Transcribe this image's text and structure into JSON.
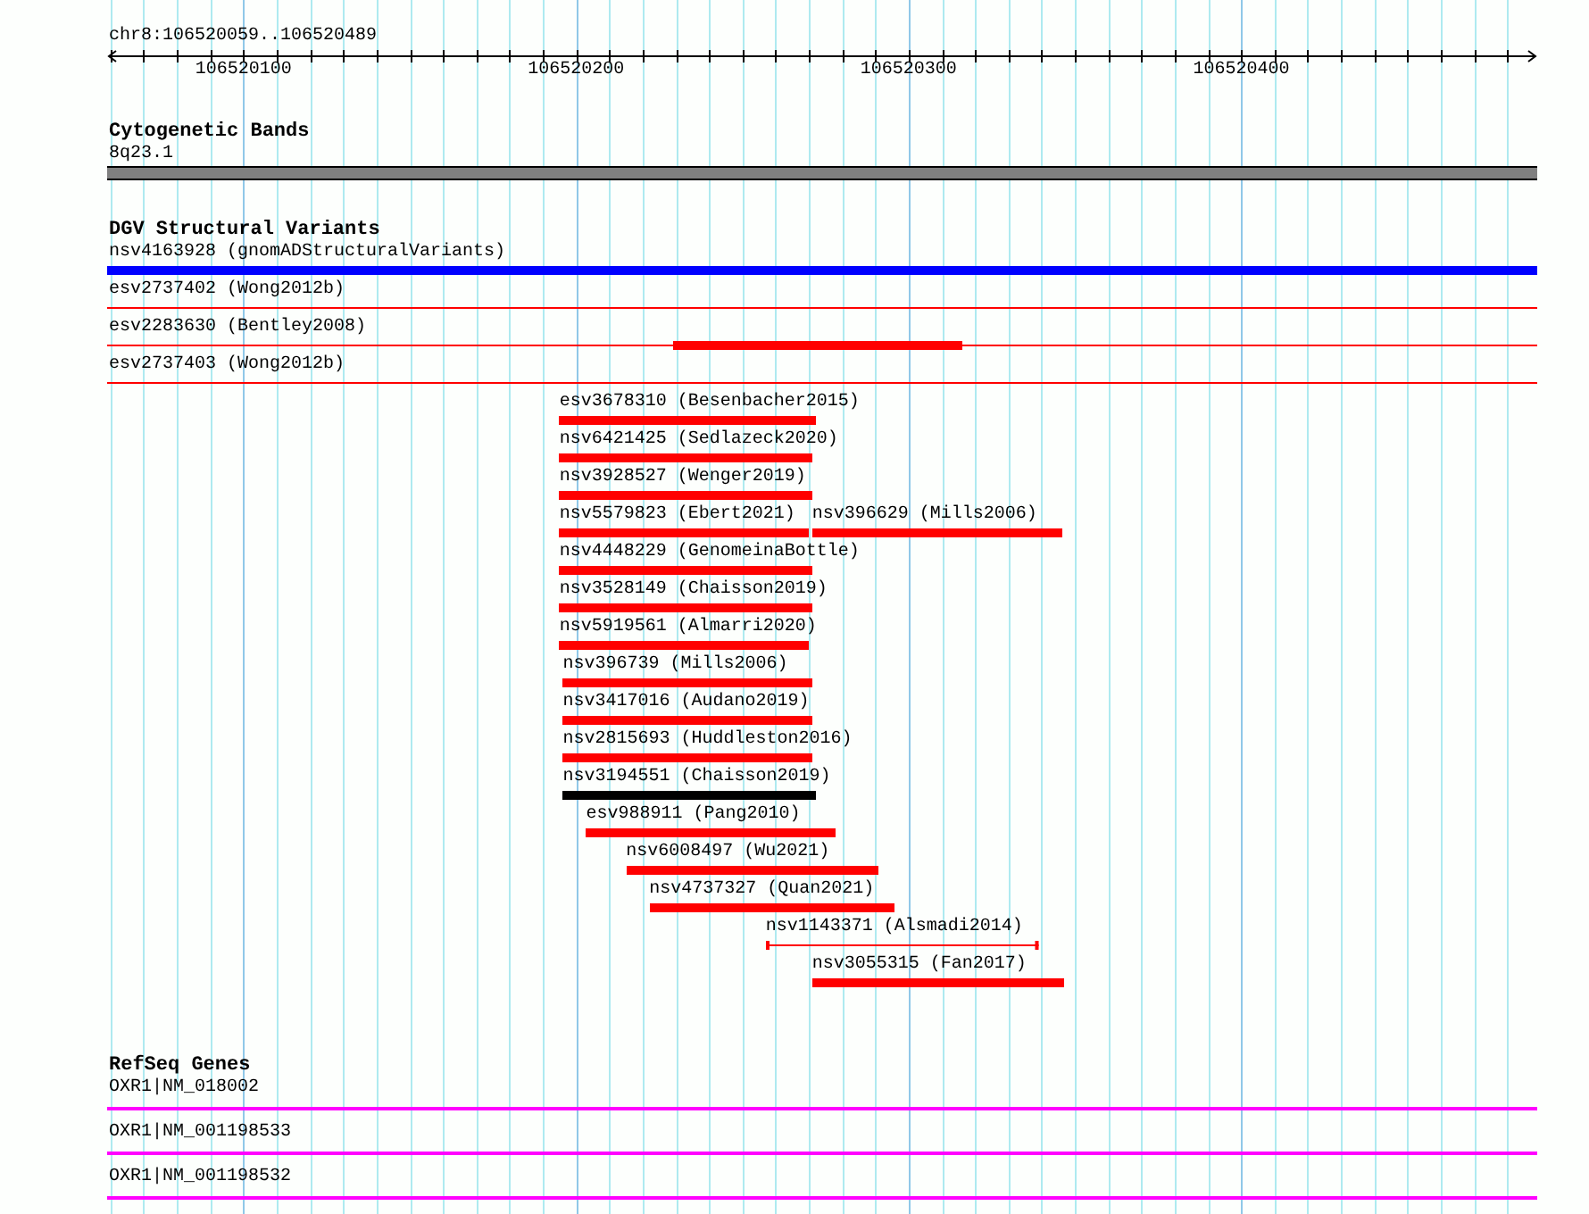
{
  "location": "chr8:106520059..106520489",
  "ruler": {
    "ticks": [
      "106520100",
      "106520200",
      "106520300",
      "106520400"
    ]
  },
  "tracks": [
    {
      "kind": "bands",
      "title": "Cytogenetic Bands",
      "rows": [
        {
          "features": [
            {
              "label": "8q23.1",
              "kind": "band",
              "color": "#808080"
            }
          ]
        }
      ]
    },
    {
      "kind": "variants",
      "title": "DGV Structural Variants",
      "rows": [
        {
          "features": [
            {
              "label": "nsv4163928 (gnomADStructuralVariants)",
              "kind": "bar",
              "color": "#0000ff"
            }
          ]
        },
        {
          "features": [
            {
              "label": "esv2737402 (Wong2012b)",
              "kind": "line",
              "color": "#ff0000"
            }
          ]
        },
        {
          "features": [
            {
              "label": "esv2283630 (Bentley2008)",
              "kind": "line-block",
              "color": "#ff0000"
            }
          ]
        },
        {
          "features": [
            {
              "label": "esv2737403 (Wong2012b)",
              "kind": "line",
              "color": "#ff0000"
            }
          ]
        },
        {
          "features": [
            {
              "label": "esv3678310 (Besenbacher2015)",
              "kind": "bar",
              "color": "#ff0000"
            }
          ]
        },
        {
          "features": [
            {
              "label": "nsv6421425 (Sedlazeck2020)",
              "kind": "bar",
              "color": "#ff0000"
            }
          ]
        },
        {
          "features": [
            {
              "label": "nsv3928527 (Wenger2019)",
              "kind": "bar",
              "color": "#ff0000"
            }
          ]
        },
        {
          "features": [
            {
              "label": "nsv5579823 (Ebert2021)",
              "kind": "bar",
              "color": "#ff0000"
            },
            {
              "label": "nsv396629 (Mills2006)",
              "kind": "bar",
              "color": "#ff0000"
            }
          ]
        },
        {
          "features": [
            {
              "label": "nsv4448229 (GenomeinaBottle)",
              "kind": "bar",
              "color": "#ff0000"
            }
          ]
        },
        {
          "features": [
            {
              "label": "nsv3528149 (Chaisson2019)",
              "kind": "bar",
              "color": "#ff0000"
            }
          ]
        },
        {
          "features": [
            {
              "label": "nsv5919561 (Almarri2020)",
              "kind": "bar",
              "color": "#ff0000"
            }
          ]
        },
        {
          "features": [
            {
              "label": "nsv396739 (Mills2006)",
              "kind": "bar",
              "color": "#ff0000"
            }
          ]
        },
        {
          "features": [
            {
              "label": "nsv3417016 (Audano2019)",
              "kind": "bar",
              "color": "#ff0000"
            }
          ]
        },
        {
          "features": [
            {
              "label": "nsv2815693 (Huddleston2016)",
              "kind": "bar",
              "color": "#ff0000"
            }
          ]
        },
        {
          "features": [
            {
              "label": "nsv3194551 (Chaisson2019)",
              "kind": "bar",
              "color": "#000000"
            }
          ]
        },
        {
          "features": [
            {
              "label": "esv988911 (Pang2010)",
              "kind": "bar",
              "color": "#ff0000"
            }
          ]
        },
        {
          "features": [
            {
              "label": "nsv6008497 (Wu2021)",
              "kind": "bar",
              "color": "#ff0000"
            }
          ]
        },
        {
          "features": [
            {
              "label": "nsv4737327 (Quan2021)",
              "kind": "bar",
              "color": "#ff0000"
            }
          ]
        },
        {
          "features": [
            {
              "label": "nsv1143371 (Alsmadi2014)",
              "kind": "capped",
              "color": "#ff0000"
            }
          ]
        },
        {
          "features": [
            {
              "label": "nsv3055315 (Fan2017)",
              "kind": "bar",
              "color": "#ff0000"
            }
          ]
        }
      ]
    },
    {
      "kind": "genes",
      "title": "RefSeq Genes",
      "rows": [
        {
          "features": [
            {
              "label": "OXR1|NM_018002",
              "kind": "gene",
              "color": "#ff00ff"
            }
          ]
        },
        {
          "features": [
            {
              "label": "OXR1|NM_001198533",
              "kind": "gene",
              "color": "#ff00ff"
            }
          ]
        },
        {
          "features": [
            {
              "label": "OXR1|NM_001198532",
              "kind": "gene",
              "color": "#ff00ff"
            }
          ]
        }
      ]
    }
  ]
}
